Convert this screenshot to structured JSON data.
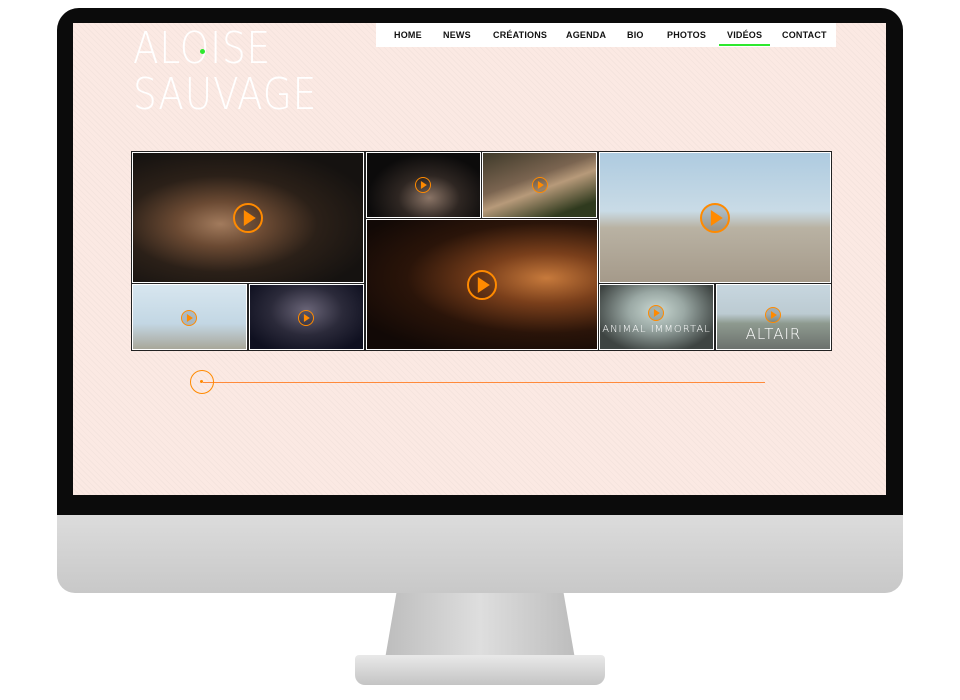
{
  "logo": {
    "line1": "ALOISE",
    "line2": "SAUVAGE"
  },
  "nav": [
    {
      "label": "HOME"
    },
    {
      "label": "NEWS"
    },
    {
      "label": "CRÉATIONS"
    },
    {
      "label": "AGENDA"
    },
    {
      "label": "BIO"
    },
    {
      "label": "PHOTOS"
    },
    {
      "label": "VIDÉOS",
      "active": true
    },
    {
      "label": "CONTACT"
    }
  ],
  "colors": {
    "accent": "#ff8a00",
    "active_underline": "#2ee82e",
    "page_bg": "#fbe9e3"
  },
  "videos": [
    {
      "id": "portrait-girl",
      "label": ""
    },
    {
      "id": "hand-black",
      "label": ""
    },
    {
      "id": "guitar-hand",
      "label": ""
    },
    {
      "id": "beach-dancer",
      "label": ""
    },
    {
      "id": "handstand-chair",
      "label": ""
    },
    {
      "id": "floor-dancer",
      "label": ""
    },
    {
      "id": "hands-face-dark",
      "label": ""
    },
    {
      "id": "animal-immortal",
      "label": "ANIMAL IMMORTAL"
    },
    {
      "id": "altair-road",
      "label": "ALTAIR"
    }
  ],
  "icons": {
    "play": "play-icon",
    "slider": "slider-handle"
  }
}
